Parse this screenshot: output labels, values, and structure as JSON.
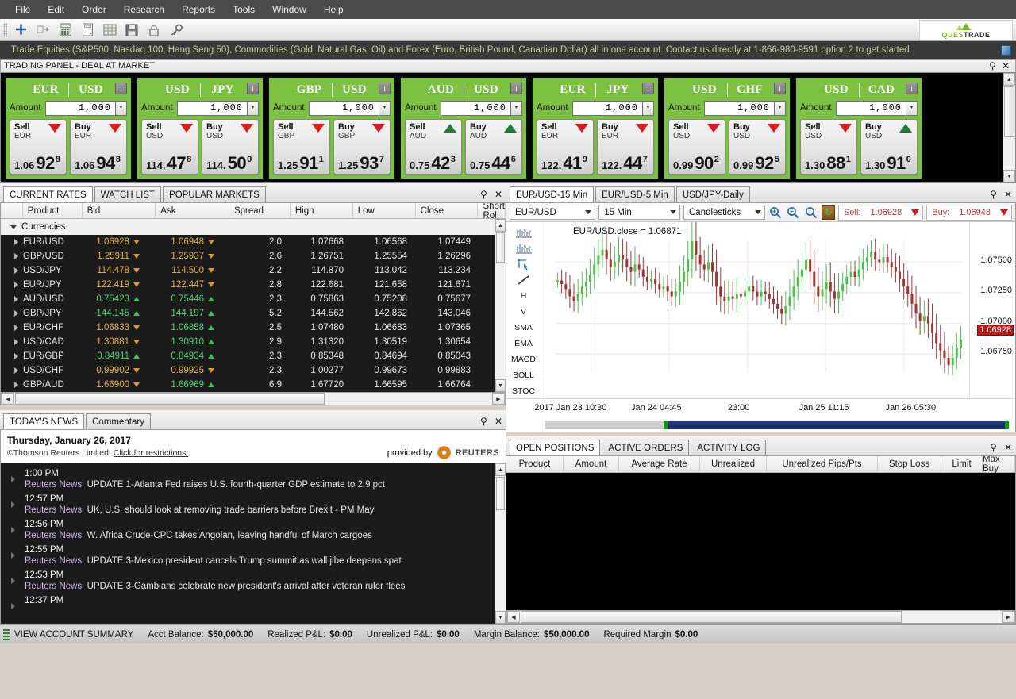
{
  "menu": {
    "items": [
      "File",
      "Edit",
      "Order",
      "Research",
      "Reports",
      "Tools",
      "Window",
      "Help"
    ]
  },
  "toolbar": {
    "icons": [
      "add-icon",
      "transfer-icon",
      "calculator-icon",
      "note-icon",
      "grid-icon",
      "save-icon",
      "lock-icon",
      "key-icon"
    ],
    "logo_ques": "QUES",
    "logo_trade": "TRADE"
  },
  "ticker": {
    "text": "Trade Equities (S&P500, Nasdaq 100, Hang Seng 50), Commodities (Gold, Natural Gas, Oil) and Forex (Euro, British Pound, Canadian Dollar) all in one account. Contact us directly at 1-866-980-9591 option 2 to get started"
  },
  "trading_panel": {
    "title": "TRADING PANEL - DEAL AT MARKET",
    "amount_label": "Amount",
    "sell_label": "Sell",
    "buy_label": "Buy",
    "info_label": "i",
    "tiles": [
      {
        "base": "EUR",
        "quote": "USD",
        "amount": "1,000",
        "deal_ccy": "EUR",
        "sell": {
          "pre": "1.06",
          "big": "92",
          "sup": "8",
          "dir": "down"
        },
        "buy": {
          "pre": "1.06",
          "big": "94",
          "sup": "8",
          "dir": "down"
        }
      },
      {
        "base": "USD",
        "quote": "JPY",
        "amount": "1,000",
        "deal_ccy": "USD",
        "sell": {
          "pre": "114.",
          "big": "47",
          "sup": "8",
          "dir": "down"
        },
        "buy": {
          "pre": "114.",
          "big": "50",
          "sup": "0",
          "dir": "down"
        }
      },
      {
        "base": "GBP",
        "quote": "USD",
        "amount": "1,000",
        "deal_ccy": "GBP",
        "sell": {
          "pre": "1.25",
          "big": "91",
          "sup": "1",
          "dir": "down"
        },
        "buy": {
          "pre": "1.25",
          "big": "93",
          "sup": "7",
          "dir": "down"
        }
      },
      {
        "base": "AUD",
        "quote": "USD",
        "amount": "1,000",
        "deal_ccy": "AUD",
        "sell": {
          "pre": "0.75",
          "big": "42",
          "sup": "3",
          "dir": "up"
        },
        "buy": {
          "pre": "0.75",
          "big": "44",
          "sup": "6",
          "dir": "up"
        }
      },
      {
        "base": "EUR",
        "quote": "JPY",
        "amount": "1,000",
        "deal_ccy": "EUR",
        "sell": {
          "pre": "122.",
          "big": "41",
          "sup": "9",
          "dir": "down"
        },
        "buy": {
          "pre": "122.",
          "big": "44",
          "sup": "7",
          "dir": "down"
        }
      },
      {
        "base": "USD",
        "quote": "CHF",
        "amount": "1,000",
        "deal_ccy": "USD",
        "sell": {
          "pre": "0.99",
          "big": "90",
          "sup": "2",
          "dir": "down"
        },
        "buy": {
          "pre": "0.99",
          "big": "92",
          "sup": "5",
          "dir": "down"
        }
      },
      {
        "base": "USD",
        "quote": "CAD",
        "amount": "1,000",
        "deal_ccy": "USD",
        "sell": {
          "pre": "1.30",
          "big": "88",
          "sup": "1",
          "dir": "down"
        },
        "buy": {
          "pre": "1.30",
          "big": "91",
          "sup": "0",
          "dir": "up"
        }
      }
    ]
  },
  "rates": {
    "tabs": [
      "CURRENT RATES",
      "WATCH LIST",
      "POPULAR MARKETS"
    ],
    "active_tab": "CURRENT RATES",
    "columns": [
      "",
      "Product",
      "Bid",
      "Ask",
      "Spread",
      "High",
      "Low",
      "Close",
      "Short Rol"
    ],
    "group_label": "Currencies",
    "rows": [
      {
        "product": "EUR/USD",
        "bid": "1.06928",
        "bid_dir": "down",
        "ask": "1.06948",
        "ask_dir": "down",
        "spread": "2.0",
        "high": "1.07668",
        "low": "1.06568",
        "close": "1.07449"
      },
      {
        "product": "GBP/USD",
        "bid": "1.25911",
        "bid_dir": "down",
        "ask": "1.25937",
        "ask_dir": "down",
        "spread": "2.6",
        "high": "1.26751",
        "low": "1.25554",
        "close": "1.26296"
      },
      {
        "product": "USD/JPY",
        "bid": "114.478",
        "bid_dir": "down",
        "ask": "114.500",
        "ask_dir": "down",
        "spread": "2.2",
        "high": "114.870",
        "low": "113.042",
        "close": "113.234"
      },
      {
        "product": "EUR/JPY",
        "bid": "122.419",
        "bid_dir": "down",
        "ask": "122.447",
        "ask_dir": "down",
        "spread": "2.8",
        "high": "122.681",
        "low": "121.658",
        "close": "121.671"
      },
      {
        "product": "AUD/USD",
        "bid": "0.75423",
        "bid_dir": "up",
        "ask": "0.75446",
        "ask_dir": "up",
        "spread": "2.3",
        "high": "0.75863",
        "low": "0.75208",
        "close": "0.75677"
      },
      {
        "product": "GBP/JPY",
        "bid": "144.145",
        "bid_dir": "up",
        "ask": "144.197",
        "ask_dir": "up",
        "spread": "5.2",
        "high": "144.562",
        "low": "142.862",
        "close": "143.046"
      },
      {
        "product": "EUR/CHF",
        "bid": "1.06833",
        "bid_dir": "down",
        "ask": "1.06858",
        "ask_dir": "up",
        "spread": "2.5",
        "high": "1.07480",
        "low": "1.06683",
        "close": "1.07365"
      },
      {
        "product": "USD/CAD",
        "bid": "1.30881",
        "bid_dir": "down",
        "ask": "1.30910",
        "ask_dir": "up",
        "spread": "2.9",
        "high": "1.31320",
        "low": "1.30519",
        "close": "1.30654"
      },
      {
        "product": "EUR/GBP",
        "bid": "0.84911",
        "bid_dir": "up",
        "ask": "0.84934",
        "ask_dir": "up",
        "spread": "2.3",
        "high": "0.85348",
        "low": "0.84694",
        "close": "0.85043"
      },
      {
        "product": "USD/CHF",
        "bid": "0.99902",
        "bid_dir": "down",
        "ask": "0.99925",
        "ask_dir": "down",
        "spread": "2.3",
        "high": "1.00277",
        "low": "0.99673",
        "close": "0.99883"
      },
      {
        "product": "GBP/AUD",
        "bid": "1.66900",
        "bid_dir": "down",
        "ask": "1.66969",
        "ask_dir": "up",
        "spread": "6.9",
        "high": "1.67720",
        "low": "1.66595",
        "close": "1.66764"
      }
    ]
  },
  "chart": {
    "tabs": [
      "EUR/USD-15 Min",
      "EUR/USD-5 Min",
      "USD/JPY-Daily"
    ],
    "active_tab": "EUR/USD-15 Min",
    "symbol": "EUR/USD",
    "interval": "15 Min",
    "style": "Candlesticks",
    "sell_label": "Sell:",
    "sell_value": "1.06928",
    "buy_label": "Buy:",
    "buy_value": "1.06948",
    "tools": [
      "chart-bars-icon",
      "chart-bars2-icon",
      "crosshair-icon",
      "trendline-icon",
      "H",
      "V",
      "SMA",
      "EMA",
      "MACD",
      "BOLL",
      "STOC"
    ],
    "close_label": "EUR/USD.close = 1.06871"
  },
  "chart_data": {
    "type": "line",
    "title": "EUR/USD.close = 1.06871",
    "xlabel": "",
    "ylabel": "",
    "ylim": [
      1.066,
      1.0768
    ],
    "y_ticks": [
      "1.07500",
      "1.07250",
      "1.07000",
      "1.06750"
    ],
    "y_tick_values": [
      1.075,
      1.0725,
      1.07,
      1.0675
    ],
    "current_price_label": "1.06928",
    "current_price": 1.06928,
    "x_ticks": [
      "2017 Jan 23 10:30",
      "Jan 24 04:45",
      "23:00",
      "Jan 25 11:15",
      "Jan 26 05:30"
    ],
    "grid": true,
    "legend": "none",
    "series": [
      {
        "name": "EUR/USD",
        "values": [
          1.0735,
          1.0732,
          1.0728,
          1.0722,
          1.0718,
          1.0724,
          1.073,
          1.0734,
          1.074,
          1.0748,
          1.0755,
          1.076,
          1.0752,
          1.0746,
          1.075,
          1.0756,
          1.0752,
          1.0746,
          1.0742,
          1.0748,
          1.0744,
          1.0738,
          1.0734,
          1.0736,
          1.0732,
          1.0728,
          1.073,
          1.0726,
          1.0722,
          1.0726,
          1.0734,
          1.0742,
          1.0752,
          1.0767,
          1.0756,
          1.0748,
          1.0744,
          1.075,
          1.0742,
          1.073,
          1.0722,
          1.0718,
          1.0722,
          1.072,
          1.0724,
          1.0722,
          1.0726,
          1.073,
          1.0726,
          1.0722,
          1.0726,
          1.0724,
          1.072,
          1.0716,
          1.0712,
          1.0708,
          1.0714,
          1.0722,
          1.073,
          1.0738,
          1.0744,
          1.0752,
          1.0742,
          1.073,
          1.0722,
          1.0728,
          1.0734,
          1.0726,
          1.072,
          1.0726,
          1.0732,
          1.0738,
          1.0742,
          1.0738,
          1.0744,
          1.075,
          1.0754,
          1.0758,
          1.0752,
          1.075,
          1.0754,
          1.075,
          1.0746,
          1.0742,
          1.0736,
          1.073,
          1.0724,
          1.0716,
          1.0708,
          1.0702,
          1.0706,
          1.07,
          1.0692,
          1.0684,
          1.0678,
          1.0672,
          1.0666,
          1.0672,
          1.068,
          1.0687
        ]
      }
    ]
  },
  "news": {
    "tabs": [
      "TODAY'S NEWS",
      "Commentary"
    ],
    "active_tab": "TODAY'S NEWS",
    "date": "Thursday, January 26, 2017",
    "copyright": "©Thomson Reuters Limited.",
    "restrictions_link": "Click for restrictions.",
    "provided_by": "provided by",
    "provider": "REUTERS",
    "items": [
      {
        "time": "1:00 PM",
        "source": "Reuters News",
        "headline": "UPDATE 1-Atlanta Fed raises U.S. fourth-quarter GDP estimate to 2.9 pct"
      },
      {
        "time": "12:57 PM",
        "source": "Reuters News",
        "headline": "UK, U.S. should look at removing trade barriers before Brexit - PM May"
      },
      {
        "time": "12:56 PM",
        "source": "Reuters News",
        "headline": "W. Africa Crude-CPC takes Angolan, leaving handful of March cargoes"
      },
      {
        "time": "12:55 PM",
        "source": "Reuters News",
        "headline": "UPDATE 3-Mexico president cancels Trump summit as wall jibe deepens spat"
      },
      {
        "time": "12:53 PM",
        "source": "Reuters News",
        "headline": "UPDATE 3-Gambians celebrate new president's arrival after veteran ruler flees"
      },
      {
        "time": "12:37 PM",
        "source": "",
        "headline": ""
      }
    ]
  },
  "positions": {
    "tabs": [
      "OPEN POSITIONS",
      "ACTIVE ORDERS",
      "ACTIVITY LOG"
    ],
    "active_tab": "OPEN POSITIONS",
    "columns": [
      "Product",
      "Amount",
      "Average Rate",
      "Unrealized",
      "Unrealized Pips/Pts",
      "Stop Loss",
      "Limit",
      "Max Buy"
    ],
    "rows": []
  },
  "status": {
    "summary_label": "VIEW ACCOUNT SUMMARY",
    "acct_balance_label": "Acct Balance:",
    "acct_balance_value": "$50,000.00",
    "realized_label": "Realized P&L:",
    "realized_value": "$0.00",
    "unrealized_label": "Unrealized P&L:",
    "unrealized_value": "$0.00",
    "margin_label": "Margin Balance:",
    "margin_value": "$50,000.00",
    "required_label": "Required Margin",
    "required_value": "$0.00"
  },
  "colors": {
    "tile_green": "#7cc142",
    "up_green": "#4fd86b",
    "down_amber": "#e8b34a",
    "accent_red": "#cc1111"
  }
}
